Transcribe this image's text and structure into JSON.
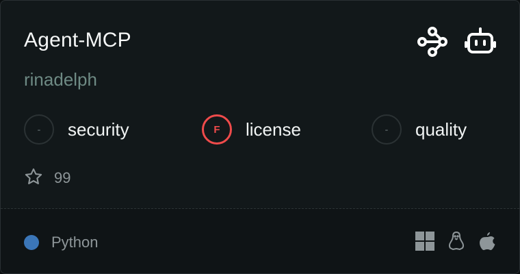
{
  "card": {
    "title": "Agent-MCP",
    "author": "rinadelph"
  },
  "header_icons": [
    "connection-icon",
    "robot-icon"
  ],
  "scores": [
    {
      "grade": "-",
      "label": "security",
      "status": "none"
    },
    {
      "grade": "F",
      "label": "license",
      "status": "fail"
    },
    {
      "grade": "-",
      "label": "quality",
      "status": "none"
    }
  ],
  "stars": {
    "count": "99"
  },
  "footer": {
    "language": "Python",
    "language_color": "#3b76b8",
    "platforms": [
      "windows-icon",
      "linux-icon",
      "apple-icon"
    ]
  },
  "colors": {
    "fail": "#ef4b4b",
    "author": "#6e8a84",
    "background": "#12181a"
  }
}
